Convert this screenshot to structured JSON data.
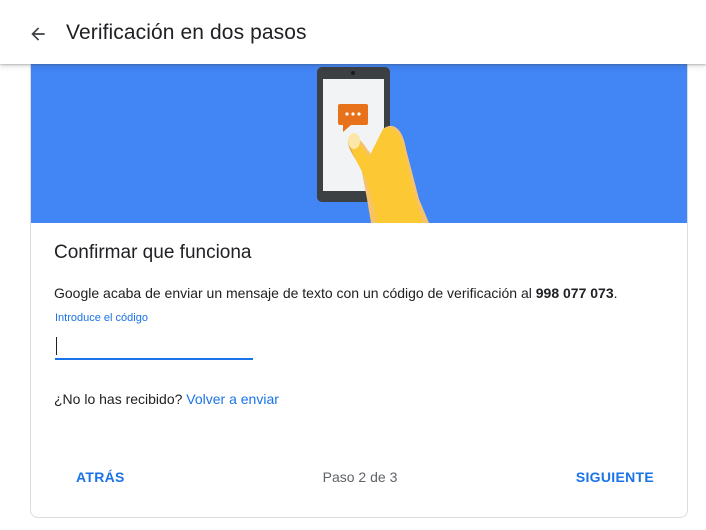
{
  "header": {
    "title": "Verificación en dos pasos",
    "back_icon": "arrow-back-icon"
  },
  "banner": {
    "background": "#4285f4",
    "illustration": "phone-in-hand-with-message-bubble",
    "bubble_color": "#e8711c"
  },
  "main": {
    "title": "Confirmar que funciona",
    "message_prefix": "Google acaba de enviar un mensaje de texto con un código de verificación al ",
    "phone_number": "998 077 073",
    "message_suffix": ".",
    "code_label": "Introduce el código",
    "code_value": "",
    "resend_question": "¿No lo has recibido?",
    "resend_link": "Volver a enviar"
  },
  "footer": {
    "back_label": "ATRÁS",
    "step_text": "Paso 2 de 3",
    "next_label": "SIGUIENTE"
  },
  "colors": {
    "accent": "#1a73e8",
    "text": "#202124",
    "muted": "#5f6368"
  }
}
